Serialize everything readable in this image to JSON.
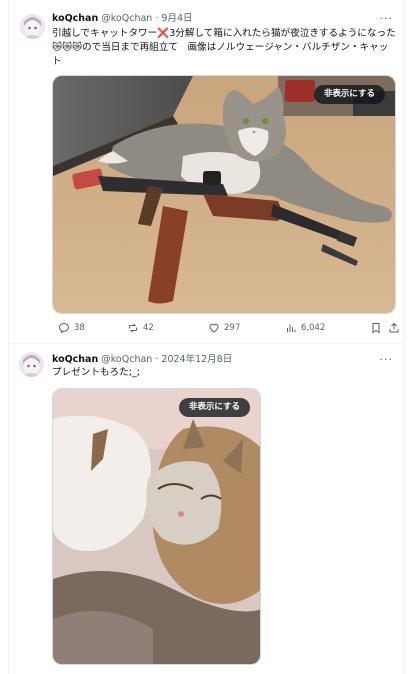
{
  "tweets": [
    {
      "display_name": "koQchan",
      "handle": "@koQchan",
      "separator": "·",
      "date": "9月4日",
      "more": "···",
      "text": "引越しでキャットタワー❌3分解して箱に入れたら猫が夜泣きするようになった😿😿😿ので当日まで再組立て　画像はノルウェージャン・バルチザン・キャット",
      "hide_button": "非表示にする",
      "stats": {
        "replies": "38",
        "reposts": "42",
        "likes": "297",
        "views": "6,042"
      }
    },
    {
      "display_name": "koQchan",
      "handle": "@koQchan",
      "separator": "·",
      "date": "2024年12月8日",
      "more": "···",
      "text": "プレゼントもろた;_;",
      "hide_button": "非表示にする"
    }
  ],
  "icons": {
    "reply": "reply-icon",
    "repost": "repost-icon",
    "like": "heart-icon",
    "views": "views-icon",
    "bookmark": "bookmark-icon",
    "share": "share-icon"
  },
  "colors": {
    "text": "#0f1419",
    "secondary": "#536471",
    "border": "#eff3f4"
  }
}
